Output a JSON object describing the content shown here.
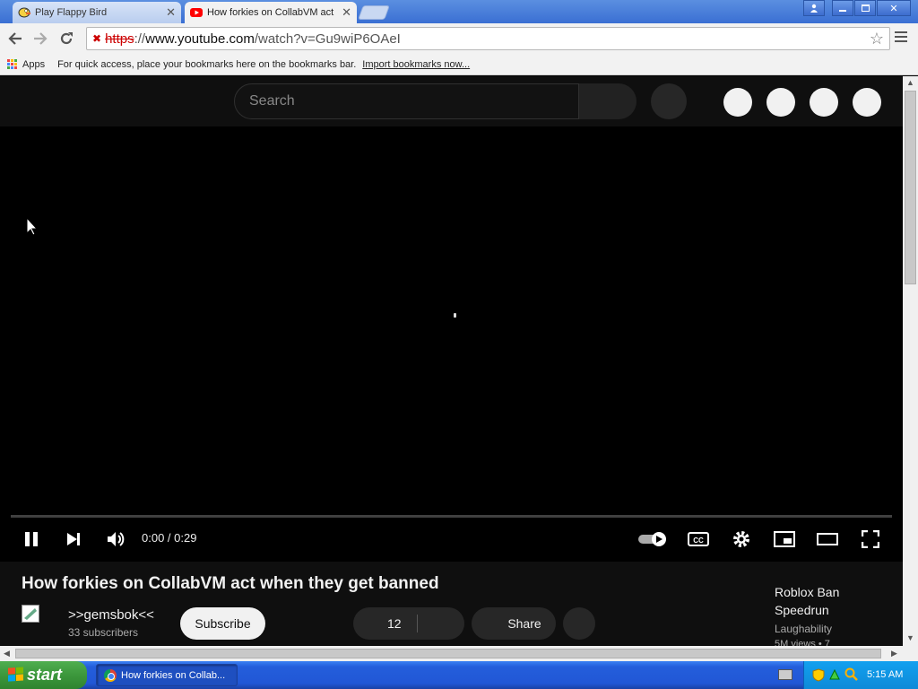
{
  "browser": {
    "tabs": [
      {
        "title": "Play Flappy Bird",
        "active": false
      },
      {
        "title": "How forkies on CollabVM act",
        "active": true
      }
    ],
    "address": {
      "scheme": "https",
      "host": "www.youtube.com",
      "path": "/watch?v=Gu9wiP6OAeI"
    },
    "bookmarks": {
      "apps_label": "Apps",
      "hint": "For quick access, place your bookmarks here on the bookmarks bar.",
      "import_link": "Import bookmarks now..."
    }
  },
  "youtube": {
    "search_placeholder": "Search",
    "player": {
      "time": "0:00 / 0:29",
      "progress": 0,
      "autoplay": true
    },
    "video": {
      "title": "How forkies on CollabVM act when they get banned",
      "channel": ">>gemsbok<<",
      "subscribers": "33 subscribers",
      "subscribe_label": "Subscribe",
      "likes": "12",
      "share_label": "Share"
    },
    "recommended": {
      "title": "Roblox Ban Speedrun",
      "channel": "Laughability",
      "views": "5M views • 7"
    }
  },
  "taskbar": {
    "start_label": "start",
    "task_title": "How forkies on Collab...",
    "clock": "5:15 AM"
  },
  "colors": {
    "youtube_red": "#ff0000",
    "xp_blue": "#245edb",
    "xp_green": "#3c973c",
    "page_bg": "#0f0f0f"
  },
  "icons": [
    "flappy-bird-favicon",
    "youtube-favicon",
    "back-icon",
    "forward-icon",
    "reload-icon",
    "insecure-lock-icon",
    "bookmark-star-icon",
    "chrome-menu-icon",
    "apps-icon",
    "pause-icon",
    "next-icon",
    "volume-icon",
    "autoplay-toggle-icon",
    "captions-icon",
    "settings-icon",
    "miniplayer-icon",
    "theater-icon",
    "fullscreen-icon",
    "windows-flag-icon",
    "chrome-icon"
  ]
}
